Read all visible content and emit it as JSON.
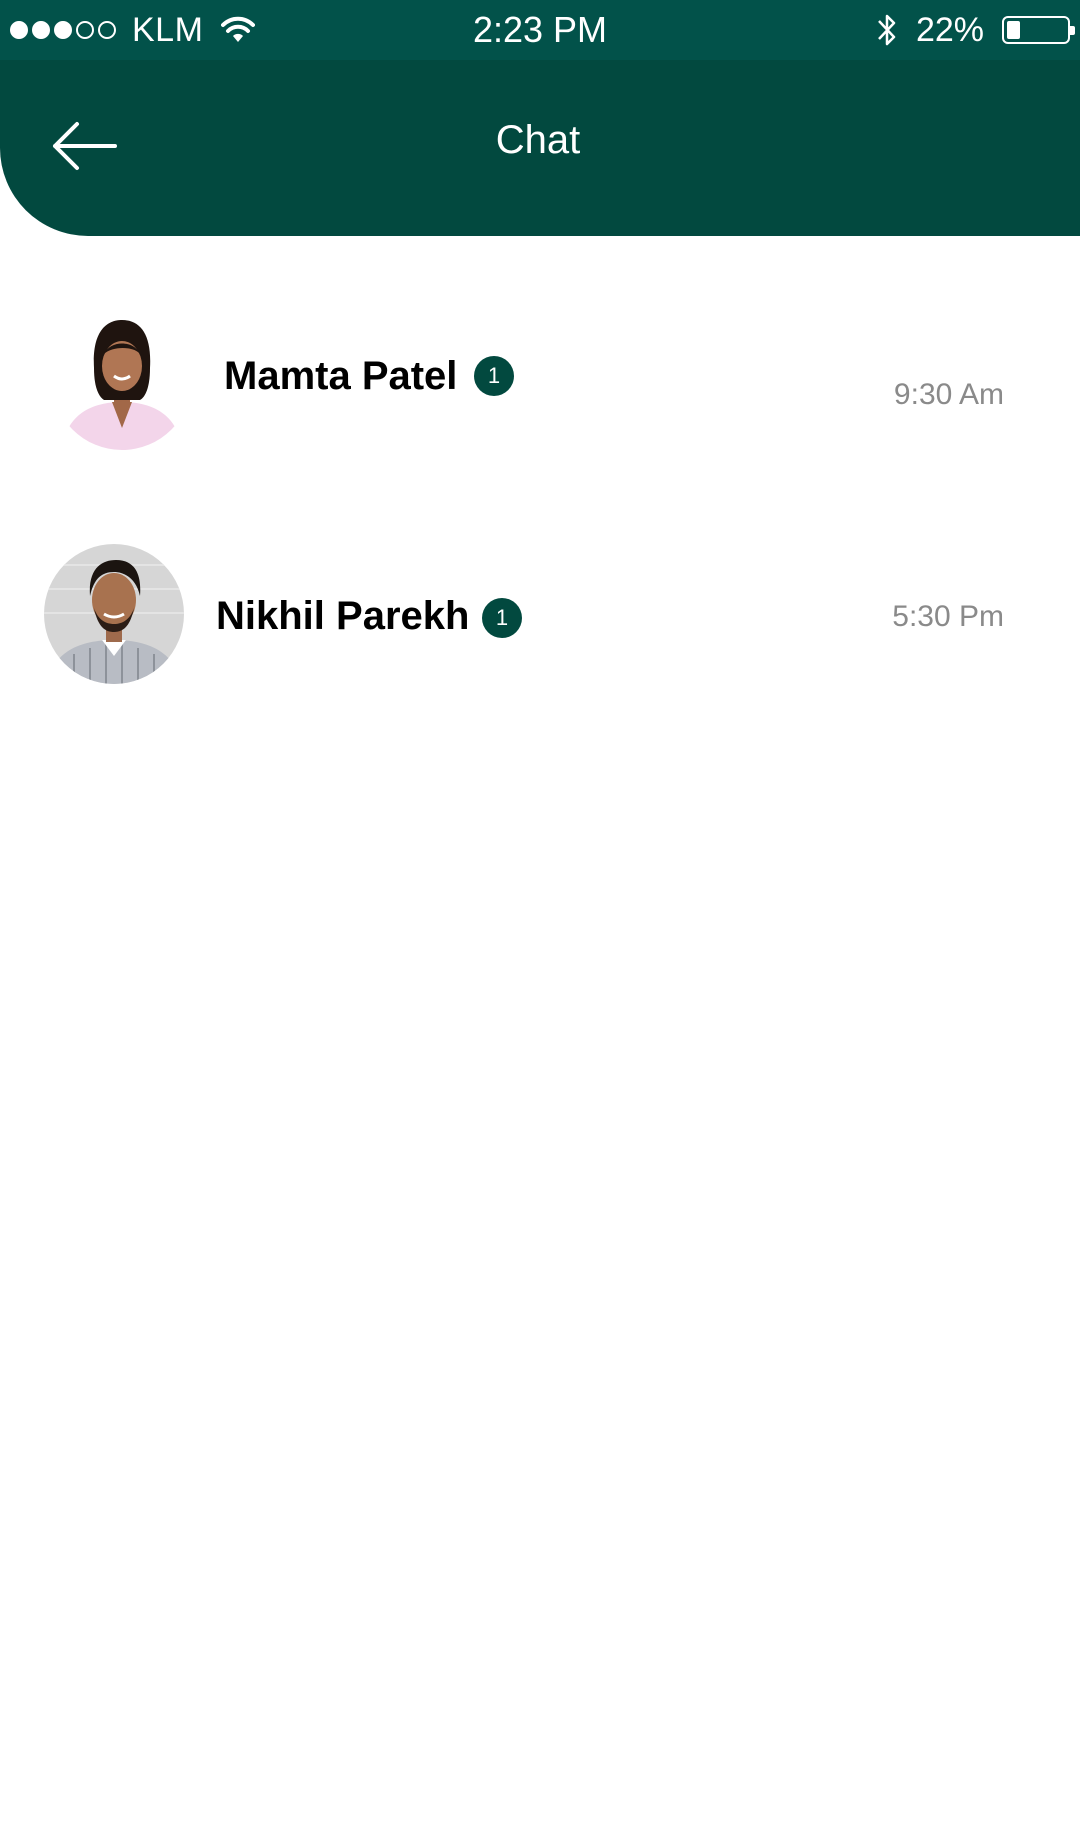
{
  "status_bar": {
    "carrier": "KLM",
    "time": "2:23 PM",
    "battery_percent": "22%",
    "battery_level": 0.22,
    "signal_bars_filled": 3,
    "signal_bars_total": 5
  },
  "header": {
    "title": "Chat",
    "back_icon": "arrow-left-icon",
    "background_color": "#02493f"
  },
  "chats": [
    {
      "name": "Mamta Patel",
      "unread": "1",
      "time": "9:30 Am",
      "avatar_icon": "avatar-woman"
    },
    {
      "name": "Nikhil Parekh",
      "unread": "1",
      "time": "5:30 Pm",
      "avatar_icon": "avatar-man"
    }
  ],
  "colors": {
    "status_bar": "#02524a",
    "accent": "#02493f",
    "time_text": "#8a8a8a"
  }
}
